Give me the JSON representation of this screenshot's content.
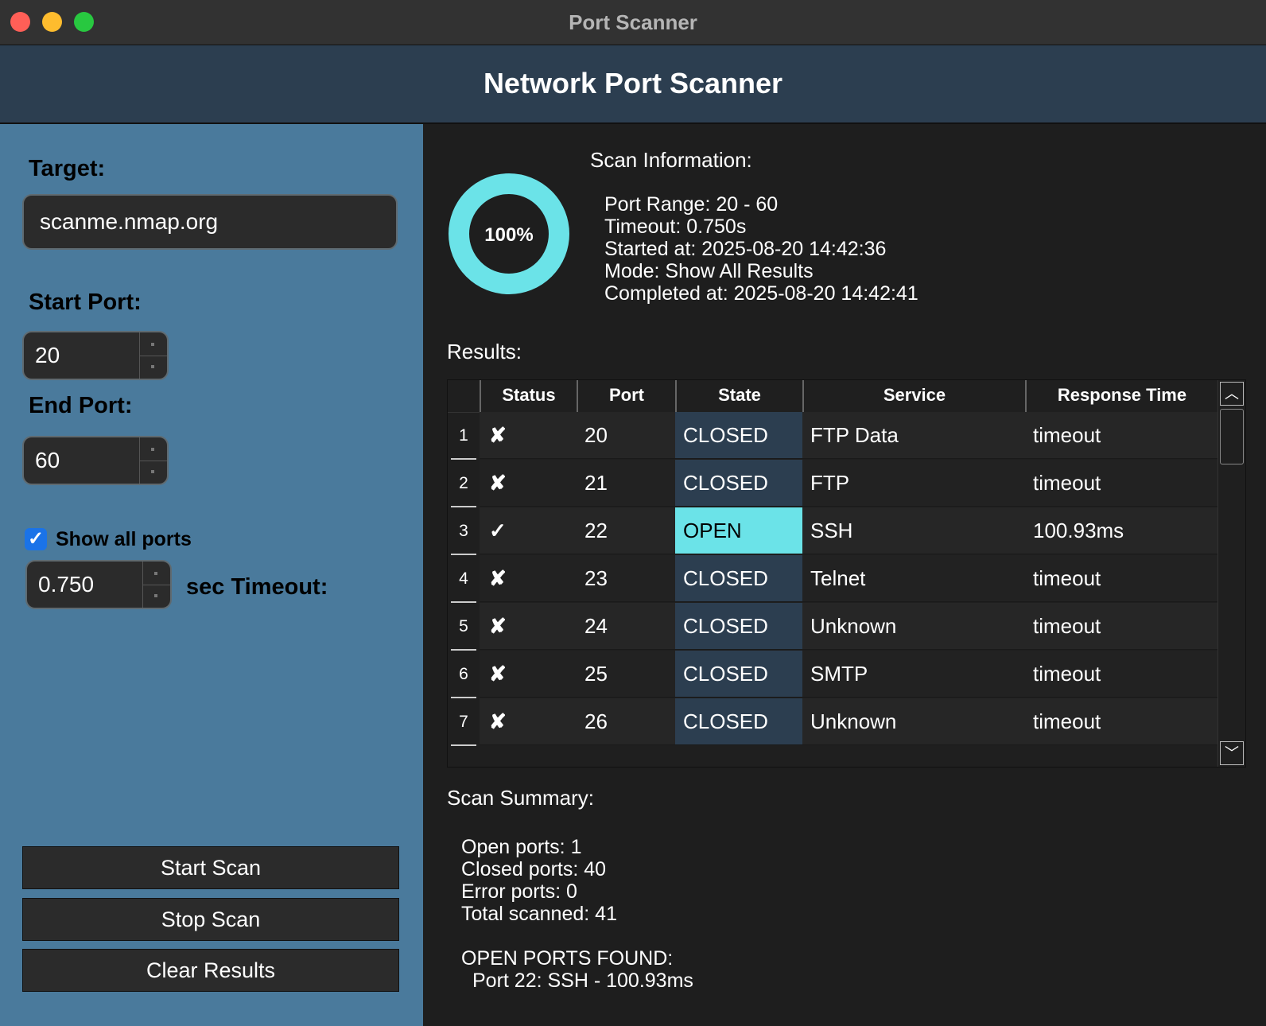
{
  "window": {
    "title": "Port Scanner"
  },
  "header": {
    "title": "Network Port Scanner"
  },
  "sidebar": {
    "target_label": "Target:",
    "target_value": "scanme.nmap.org",
    "start_port_label": "Start Port:",
    "start_port_value": "20",
    "end_port_label": "End Port:",
    "end_port_value": "60",
    "show_all_label": "Show all ports",
    "show_all_checked": true,
    "timeout_value": "0.750",
    "timeout_label": "sec Timeout:",
    "start_button": "Start Scan",
    "stop_button": "Stop Scan",
    "clear_button": "Clear Results"
  },
  "scan_info": {
    "label": "Scan Information:",
    "progress": 1.0,
    "progress_text": "100%",
    "progress_color": "#6be3e8",
    "lines": [
      "Port Range: 20 - 60",
      "Timeout: 0.750s",
      "Started at: 2025-08-20 14:42:36",
      "Mode: Show All Results",
      "Completed at: 2025-08-20 14:42:41"
    ]
  },
  "results": {
    "label": "Results:",
    "columns": [
      "Status",
      "Port",
      "State",
      "Service",
      "Response Time"
    ],
    "rows": [
      {
        "index": "1",
        "status": "✘",
        "port": "20",
        "state": "CLOSED",
        "service": "FTP Data",
        "response": "timeout"
      },
      {
        "index": "2",
        "status": "✘",
        "port": "21",
        "state": "CLOSED",
        "service": "FTP",
        "response": "timeout"
      },
      {
        "index": "3",
        "status": "✓",
        "port": "22",
        "state": "OPEN",
        "service": "SSH",
        "response": "100.93ms"
      },
      {
        "index": "4",
        "status": "✘",
        "port": "23",
        "state": "CLOSED",
        "service": "Telnet",
        "response": "timeout"
      },
      {
        "index": "5",
        "status": "✘",
        "port": "24",
        "state": "CLOSED",
        "service": "Unknown",
        "response": "timeout"
      },
      {
        "index": "6",
        "status": "✘",
        "port": "25",
        "state": "CLOSED",
        "service": "SMTP",
        "response": "timeout"
      },
      {
        "index": "7",
        "status": "✘",
        "port": "26",
        "state": "CLOSED",
        "service": "Unknown",
        "response": "timeout"
      }
    ],
    "open_color": "#6be3e8",
    "closed_color": "#2c3e50"
  },
  "summary": {
    "label": "Scan Summary:",
    "open": "Open ports: 1",
    "closed": "Closed ports: 40",
    "error": "Error ports: 0",
    "total": "Total scanned: 41",
    "open_found_label": "OPEN PORTS FOUND:",
    "open_found_items": [
      "Port 22: SSH - 100.93ms"
    ]
  }
}
